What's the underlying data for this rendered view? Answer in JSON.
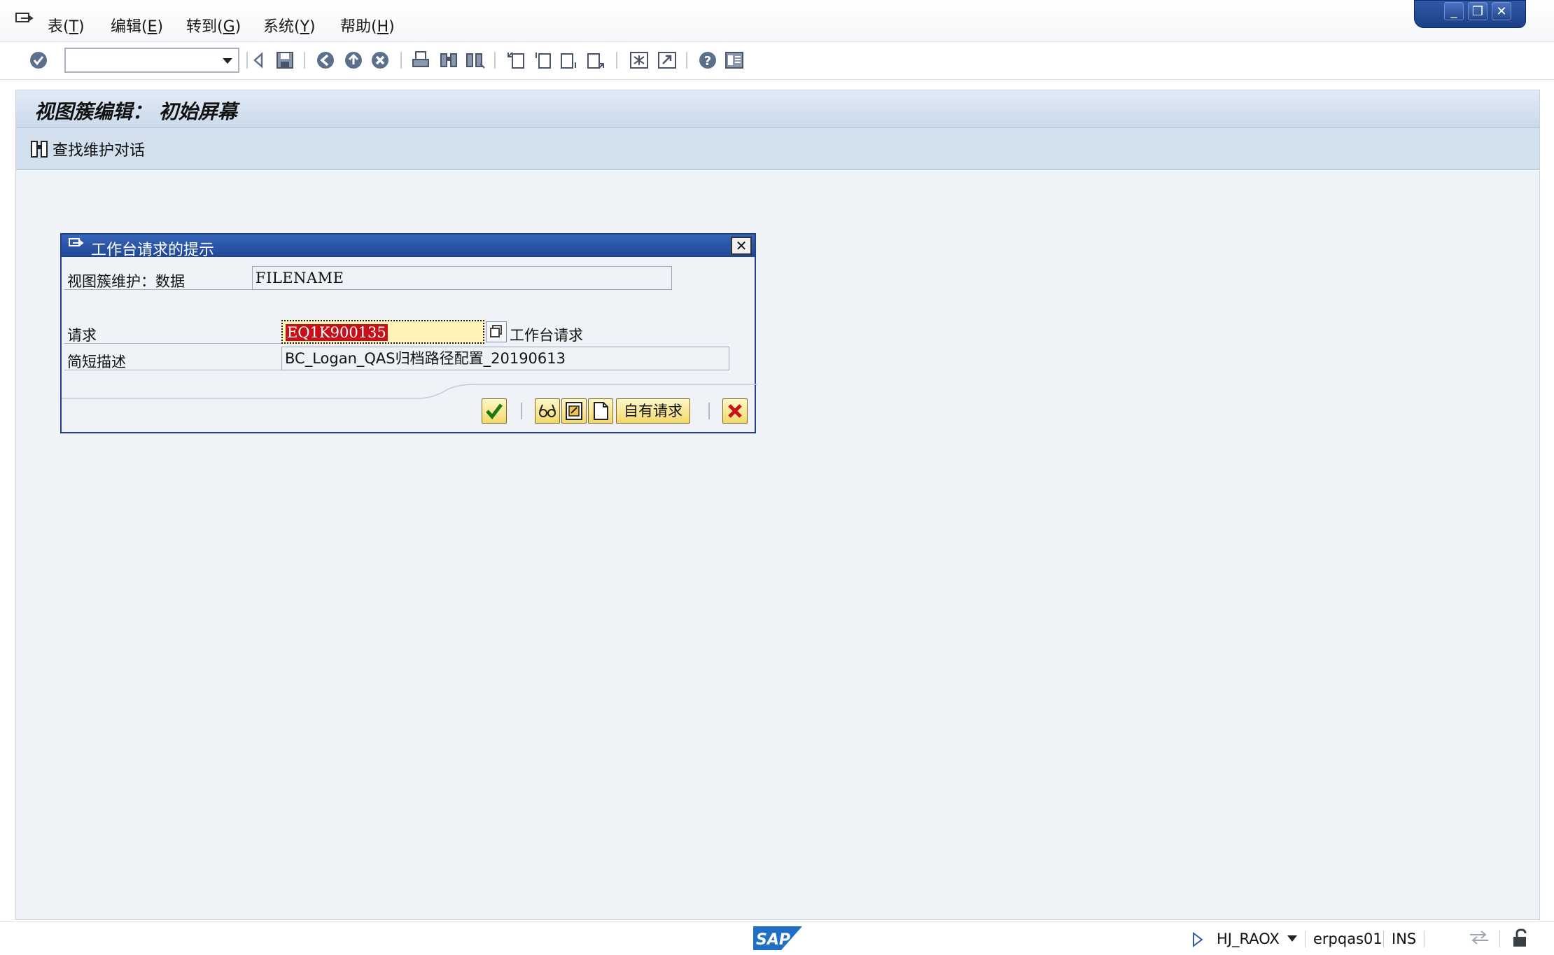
{
  "menu": {
    "items": [
      {
        "label": "表(",
        "key": "T",
        "close": ")"
      },
      {
        "label": "编辑(",
        "key": "E",
        "close": ")"
      },
      {
        "label": "转到(",
        "key": "G",
        "close": ")"
      },
      {
        "label": "系统(",
        "key": "Y",
        "close": ")"
      },
      {
        "label": "帮助(",
        "key": "H",
        "close": ")"
      }
    ]
  },
  "command_field": {
    "value": ""
  },
  "screen": {
    "title": "视图簇编辑： 初始屏幕",
    "find_dialog_label": "查找维护对话"
  },
  "dialog": {
    "title": "工作台请求的提示",
    "rows": {
      "view_cluster_label": "视图簇维护：数据",
      "view_cluster_value": "FILENAME",
      "request_label": "请求",
      "request_value": "EQ1K900135",
      "request_type_label": "工作台请求",
      "short_desc_label": "简短描述",
      "short_desc_value": "BC_Logan_QAS归档路径配置_20190613"
    },
    "own_requests_label": "自有请求"
  },
  "status": {
    "user": "HJ_RAOX",
    "server": "erpqas01",
    "mode": "INS"
  },
  "colors": {
    "accent": "#1f4797",
    "selection": "#c8101a",
    "input_highlight": "#fff3b8"
  }
}
